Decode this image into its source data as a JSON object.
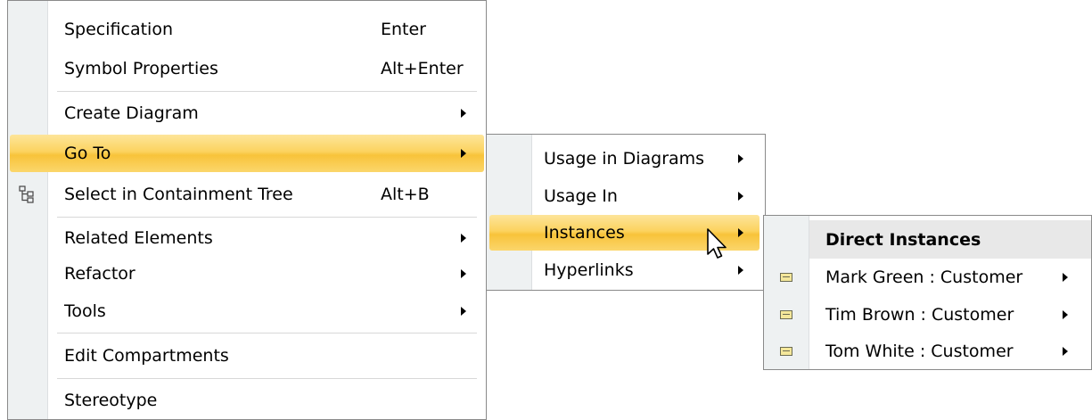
{
  "main_menu": {
    "items": [
      {
        "label": "Specification",
        "shortcut": "Enter"
      },
      {
        "label": "Symbol Properties",
        "shortcut": "Alt+Enter"
      },
      {
        "label": "Create Diagram"
      },
      {
        "label": "Go To"
      },
      {
        "label": "Select in Containment Tree",
        "shortcut": "Alt+B",
        "icon": "containment-tree-icon"
      },
      {
        "label": "Related Elements"
      },
      {
        "label": "Refactor"
      },
      {
        "label": "Tools"
      },
      {
        "label": "Edit Compartments"
      },
      {
        "label": "Stereotype"
      }
    ]
  },
  "goto_submenu": {
    "items": [
      {
        "label": "Usage in Diagrams"
      },
      {
        "label": "Usage In"
      },
      {
        "label": "Instances"
      },
      {
        "label": "Hyperlinks"
      }
    ]
  },
  "instances_submenu": {
    "header": "Direct Instances",
    "items": [
      {
        "label": "Mark Green : Customer",
        "icon": "instance-specification-icon"
      },
      {
        "label": "Tim Brown : Customer",
        "icon": "instance-specification-icon"
      },
      {
        "label": "Tom White : Customer",
        "icon": "instance-specification-icon"
      }
    ]
  },
  "colors": {
    "highlight": "#fcd35f",
    "gutter": "#eef1f2",
    "border": "#8a8a8a"
  }
}
